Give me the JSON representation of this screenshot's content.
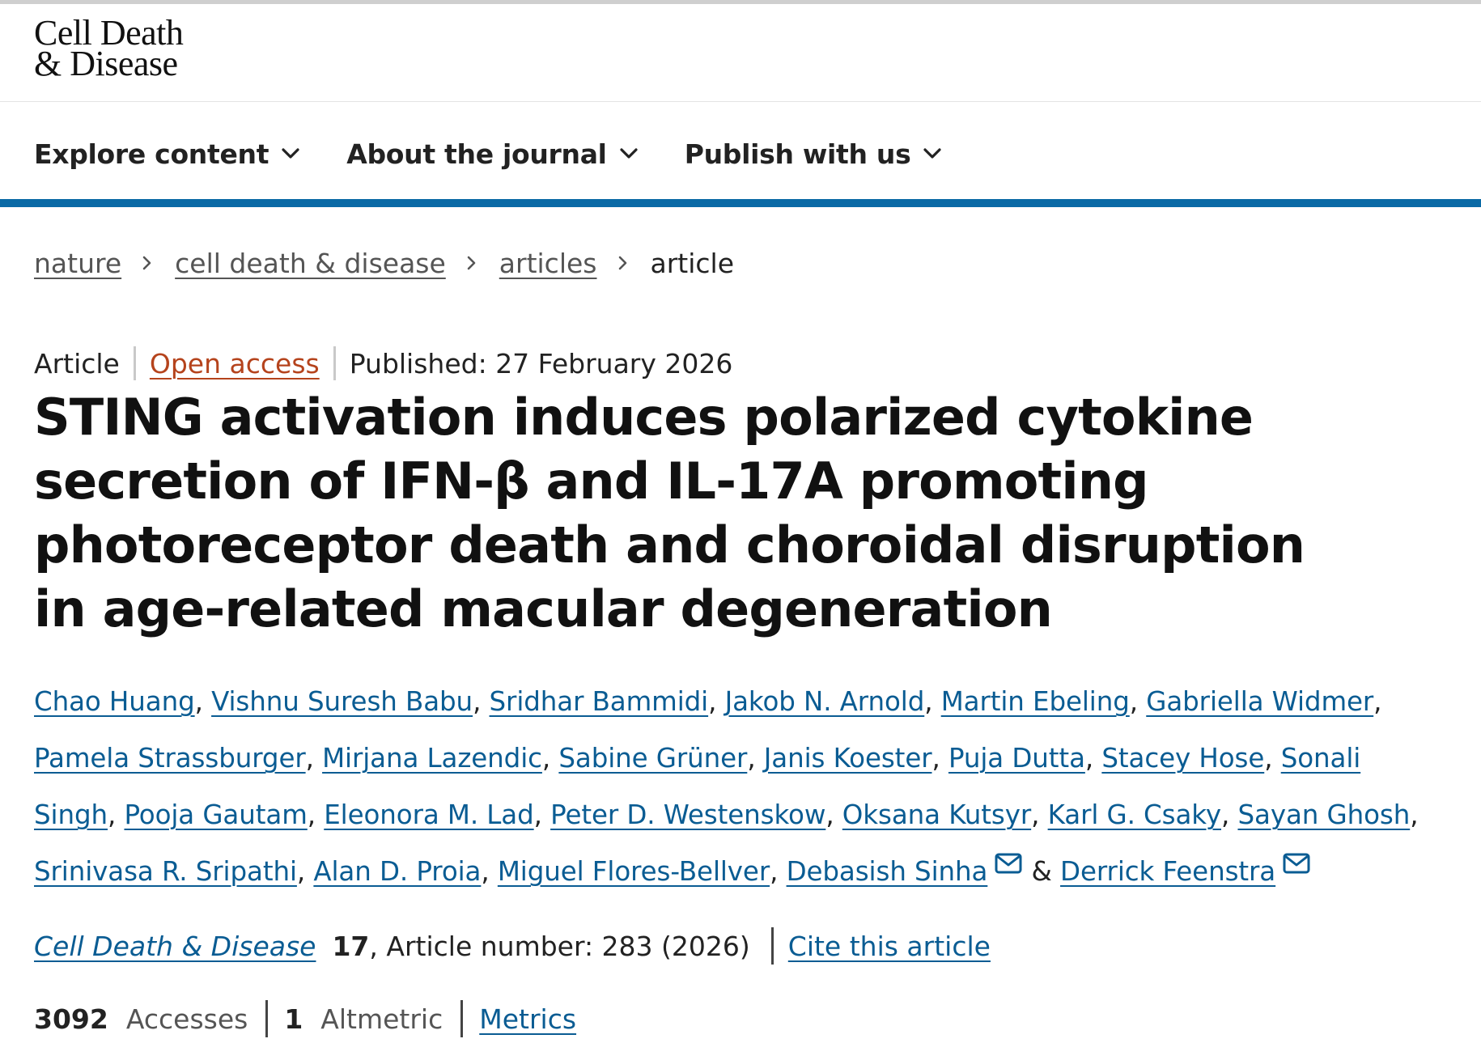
{
  "site": {
    "logo_line1": "Cell Death",
    "logo_line2": "& Disease"
  },
  "nav": {
    "items": [
      {
        "label": "Explore content"
      },
      {
        "label": "About the journal"
      },
      {
        "label": "Publish with us"
      }
    ]
  },
  "breadcrumb": {
    "items": [
      {
        "label": "nature"
      },
      {
        "label": "cell death & disease"
      },
      {
        "label": "articles"
      },
      {
        "label": "article"
      }
    ]
  },
  "article": {
    "type": "Article",
    "access": "Open access",
    "published": "Published: 27 February 2026",
    "title": "STING activation induces polarized cytokine secretion of IFN-β and IL-17A promoting photoreceptor death and choroidal disruption in age-related macular degeneration",
    "authors": [
      "Chao Huang",
      "Vishnu Suresh Babu",
      "Sridhar Bammidi",
      "Jakob N. Arnold",
      "Martin Ebeling",
      "Gabriella Widmer",
      "Pamela Strassburger",
      "Mirjana Lazendic",
      "Sabine Grüner",
      "Janis Koester",
      "Puja Dutta",
      "Stacey Hose",
      "Sonali Singh",
      "Pooja Gautam",
      "Eleonora M. Lad",
      "Peter D. Westenskow",
      "Oksana Kutsyr",
      "Karl G. Csaky",
      "Sayan Ghosh",
      "Srinivasa R. Sripathi",
      "Alan D. Proia",
      "Miguel Flores-Bellver",
      "Debasish Sinha",
      "Derrick Feenstra"
    ],
    "authors_sep": ", ",
    "authors_last_sep": " & ",
    "journal": "Cell Death & Disease",
    "volume": "17",
    "article_number_text": ", Article number: 283 (2026)",
    "cite_label": "Cite this article"
  },
  "metrics": {
    "accesses_value": "3092",
    "accesses_label": "Accesses",
    "altmetric_value": "1",
    "altmetric_label": "Altmetric",
    "metrics_link": "Metrics"
  },
  "colors": {
    "link_blue": "#0a5c93",
    "nav_bar_blue": "#0a6aa6",
    "open_access_orange": "#b5431c"
  },
  "icons": {
    "nav_dropdown": "chevron-down-icon",
    "breadcrumb_separator": "chevron-right-icon",
    "corresponding_author": "mail-icon"
  }
}
